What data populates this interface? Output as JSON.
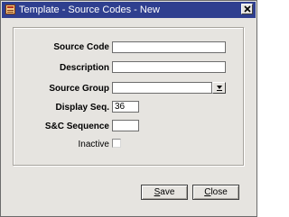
{
  "window": {
    "title": "Template - Source Codes - New"
  },
  "form": {
    "source_code": {
      "label": "Source Code",
      "value": ""
    },
    "description": {
      "label": "Description",
      "value": ""
    },
    "source_group": {
      "label": "Source Group",
      "value": ""
    },
    "display_seq": {
      "label": "Display Seq.",
      "value": "36"
    },
    "sc_sequence": {
      "label": "S&C Sequence",
      "value": ""
    },
    "inactive": {
      "label": "Inactive",
      "checked": false
    }
  },
  "buttons": {
    "save_label": "Save",
    "close_label": "Close"
  },
  "icons": {
    "app": "template-app-icon",
    "close": "close-icon",
    "dropdown": "dropdown-arrow-icon"
  }
}
